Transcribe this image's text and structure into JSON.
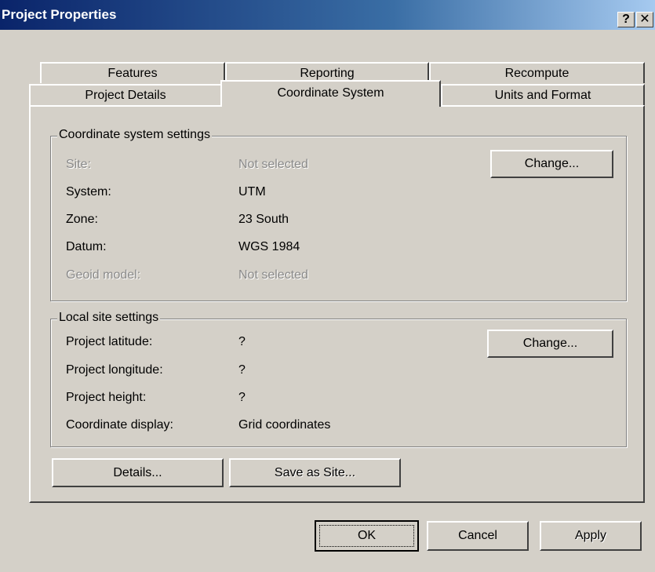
{
  "window": {
    "title": "Project Properties",
    "help_button": "?",
    "close_button": "✕"
  },
  "tabs": {
    "row1": [
      "Features",
      "Reporting",
      "Recompute"
    ],
    "row2": [
      "Project Details",
      "Coordinate System",
      "Units and Format"
    ],
    "active": "Coordinate System"
  },
  "coord_group": {
    "legend": "Coordinate system settings",
    "change_button": "Change...",
    "rows": [
      {
        "label": "Site:",
        "value": "Not selected",
        "disabled": true
      },
      {
        "label": "System:",
        "value": "UTM",
        "disabled": false
      },
      {
        "label": "Zone:",
        "value": "23 South",
        "disabled": false
      },
      {
        "label": "Datum:",
        "value": "WGS 1984",
        "disabled": false
      },
      {
        "label": "Geoid model:",
        "value": "Not selected",
        "disabled": true
      }
    ]
  },
  "local_group": {
    "legend": "Local site settings",
    "change_button": "Change...",
    "rows": [
      {
        "label": "Project latitude:",
        "value": "?"
      },
      {
        "label": "Project longitude:",
        "value": "?"
      },
      {
        "label": "Project height:",
        "value": "?"
      },
      {
        "label": "Coordinate display:",
        "value": "Grid coordinates"
      }
    ]
  },
  "panel_buttons": {
    "details": "Details...",
    "save_as_site": "Save as Site..."
  },
  "dialog_buttons": {
    "ok": "OK",
    "cancel": "Cancel",
    "apply": "Apply"
  }
}
